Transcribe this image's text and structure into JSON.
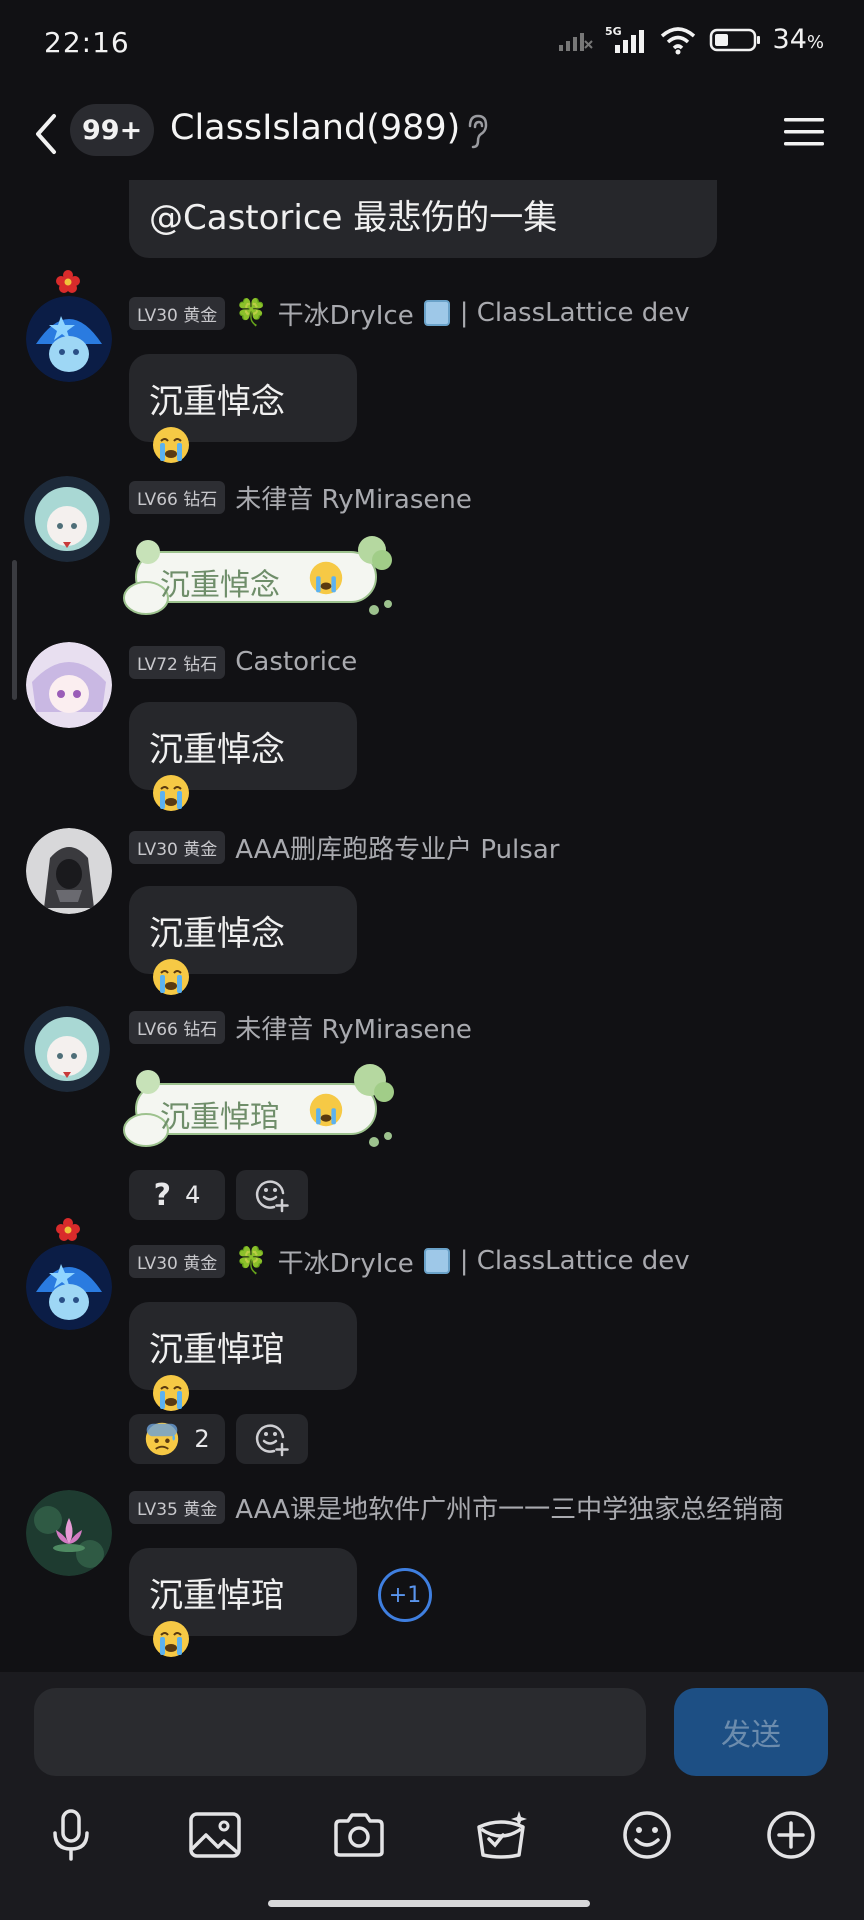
{
  "status_bar": {
    "time": "22:16",
    "network": "5G",
    "battery": "34",
    "battery_unit": "%"
  },
  "header": {
    "unread_count": "99+",
    "title": "ClassIsland(989)"
  },
  "messages": [
    {
      "text": "@Castorice 最悲伤的一集"
    },
    {
      "level": "LV30 黄金",
      "name": "干冰DryIce",
      "name_suffix": "| ClassLattice dev",
      "text": "沉重悼念"
    },
    {
      "level": "LV66 钻石",
      "name": "未律音 RyMirasene",
      "sticker_text": "沉重悼念"
    },
    {
      "level": "LV72 钻石",
      "name": "Castorice",
      "text": "沉重悼念"
    },
    {
      "level": "LV30 黄金",
      "name": "AAA删库跑路专业户 Pulsar",
      "text": "沉重悼念"
    },
    {
      "level": "LV66 钻石",
      "name": "未律音 RyMirasene",
      "sticker_text": "沉重悼琯",
      "reaction_count": "4"
    },
    {
      "level": "LV30 黄金",
      "name": "干冰DryIce",
      "name_suffix": "| ClassLattice dev",
      "text": "沉重悼琯",
      "reaction_count": "2"
    },
    {
      "level": "LV35 黄金",
      "name": "AAA课是地软件广州市一一三中学独家总经销商",
      "text": "沉重悼琯",
      "plus_one": "+1"
    }
  ],
  "composer": {
    "placeholder": "",
    "send_label": "发送"
  },
  "toolbar": [
    "microphone-icon",
    "image-icon",
    "camera-icon",
    "red-packet-icon",
    "emoji-icon",
    "plus-icon"
  ],
  "colors": {
    "background": "#111114",
    "bubble": "#26272b",
    "accent": "#1d4f84",
    "plus_one": "#3f7fe0"
  }
}
